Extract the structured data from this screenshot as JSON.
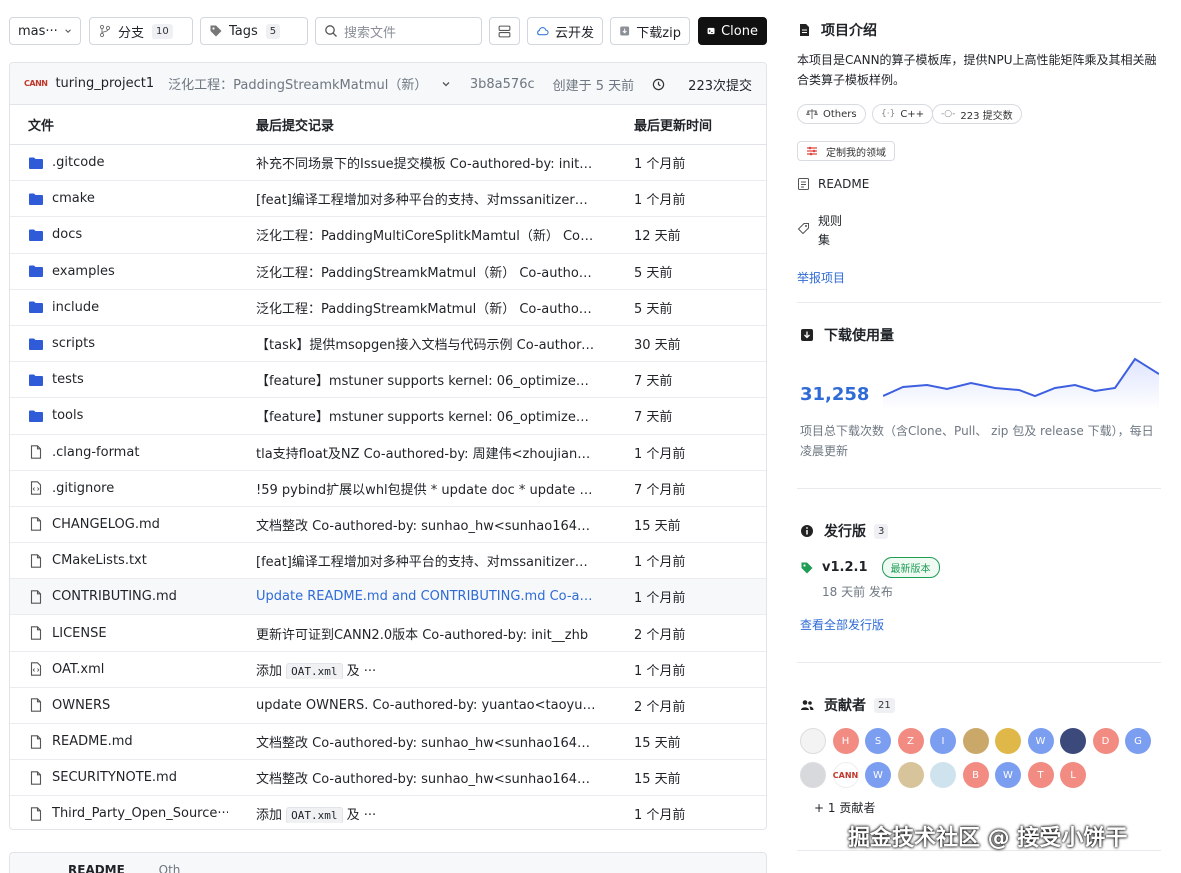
{
  "toolbar": {
    "branch": "mas···",
    "branches_label": "分支",
    "branches_count": "10",
    "tags_label": "Tags",
    "tags_count": "5",
    "search_placeholder": "搜索文件",
    "cloud_label": "云开发",
    "download_label": "下载zip",
    "clone_label": "Clone"
  },
  "commit": {
    "logo": "CANN",
    "repo": "turing_project1",
    "message": "泛化工程：PaddingStreamkMatmul（新）",
    "hash": "3b8a576c",
    "created": "创建于 5 天前",
    "commits": "223次提交"
  },
  "table": {
    "headers": {
      "file": "文件",
      "commit": "最后提交记录",
      "time": "最后更新时间"
    },
    "rows": [
      {
        "type": "folder",
        "name": ".gitcode",
        "msg": "补充不同场景下的Issue提交模板 Co-authored-by: init__zhb",
        "time": "1 个月前"
      },
      {
        "type": "folder",
        "name": "cmake",
        "msg": "[feat]编译工程增加对多种平台的支持、对mssanitizer的支持",
        "time": "1 个月前"
      },
      {
        "type": "folder",
        "name": "docs",
        "msg": "泛化工程：PaddingMultiCoreSplitkMamtul（新） Co-authored-by",
        "time": "12 天前"
      },
      {
        "type": "folder",
        "name": "examples",
        "msg": "泛化工程：PaddingStreamkMatmul（新） Co-authored-by",
        "time": "5 天前"
      },
      {
        "type": "folder",
        "name": "include",
        "msg": "泛化工程：PaddingStreamkMatmul（新） Co-authored-by",
        "time": "5 天前"
      },
      {
        "type": "folder",
        "name": "scripts",
        "msg": "【task】提供msopgen接入文档与代码示例 Co-authored-by",
        "time": "30 天前"
      },
      {
        "type": "folder",
        "name": "tests",
        "msg": "【feature】mstuner supports kernel: 06_optimized_matmul",
        "time": "7 天前"
      },
      {
        "type": "folder",
        "name": "tools",
        "msg": "【feature】mstuner supports kernel: 06_optimized_matmul",
        "time": "7 天前"
      },
      {
        "type": "file",
        "name": ".clang-format",
        "msg": "tla支持float及NZ Co-authored-by: 周建伟<zhoujianwei4",
        "time": "1 个月前"
      },
      {
        "type": "code",
        "name": ".gitignore",
        "msg": "!59 pybind扩展以whl包提供 * update doc * update cmake",
        "time": "7 个月前"
      },
      {
        "type": "file",
        "name": "CHANGELOG.md",
        "msg": "文档整改 Co-authored-by: sunhao_hw<sunhao164@h-partners",
        "time": "15 天前"
      },
      {
        "type": "file",
        "name": "CMakeLists.txt",
        "msg": "[feat]编译工程增加对多种平台的支持、对mssanitizer的支持",
        "time": "1 个月前"
      },
      {
        "type": "file",
        "name": "CONTRIBUTING.md",
        "msg": "Update README.md and CONTRIBUTING.md Co-authored-by",
        "time": "1 个月前"
      },
      {
        "type": "file",
        "name": "LICENSE",
        "msg": "更新许可证到CANN2.0版本 Co-authored-by: init__zhb",
        "time": "2 个月前"
      },
      {
        "type": "code",
        "name": "OAT.xml",
        "msg_pre": "添加 ",
        "msg_code": "OAT.xml",
        "msg_post": " 及 ···",
        "time": "1 个月前"
      },
      {
        "type": "file",
        "name": "OWNERS",
        "msg": "update OWNERS. Co-authored-by: yuantao<taoyuan15",
        "time": "2 个月前"
      },
      {
        "type": "file",
        "name": "README.md",
        "msg": "文档整改 Co-authored-by: sunhao_hw<sunhao164@h-partners",
        "time": "15 天前"
      },
      {
        "type": "file",
        "name": "SECURITYNOTE.md",
        "msg": "文档整改 Co-authored-by: sunhao_hw<sunhao164@h-partners",
        "time": "15 天前"
      },
      {
        "type": "file",
        "name": "Third_Party_Open_Source···",
        "msg_pre": "添加 ",
        "msg_code": "OAT.xml",
        "msg_post": " 及 ···",
        "time": "1 个月前"
      }
    ]
  },
  "readme_bar": {
    "label": "README",
    "other": "Oth"
  },
  "sidebar": {
    "intro_title": "项目介绍",
    "intro_desc": "本项目是CANN的算子模板库，提供NPU上高性能矩阵乘及其相关融合类算子模板样例。",
    "pill_license": "Others",
    "pill_lang": "C++",
    "pill_commits": "223 提交数",
    "pill_domain": "定制我的领域",
    "readme": "README",
    "rules": "规则集",
    "report": "举报项目",
    "downloads_title": "下载使用量",
    "downloads_count": "31,258",
    "downloads_desc": "项目总下载次数（含Clone、Pull、 zip 包及 release 下载），每日凌晨更新",
    "releases_title": "发行版",
    "releases_count": "3",
    "release_version": "v1.2.1",
    "release_badge": "最新版本",
    "release_time": "18 天前 发布",
    "view_all": "查看全部发行版",
    "contributors_title": "贡献者",
    "contributors_count": "21",
    "more_contributors": "+ 1 贡献者",
    "avatars": [
      "",
      "H",
      "S",
      "Z",
      "I",
      "",
      "",
      "W",
      "",
      "D",
      "G",
      "",
      "CANN",
      "W",
      "",
      "",
      "B",
      "W",
      "T",
      "L"
    ]
  },
  "watermark": "掘金技术社区 @ 接受小饼干"
}
